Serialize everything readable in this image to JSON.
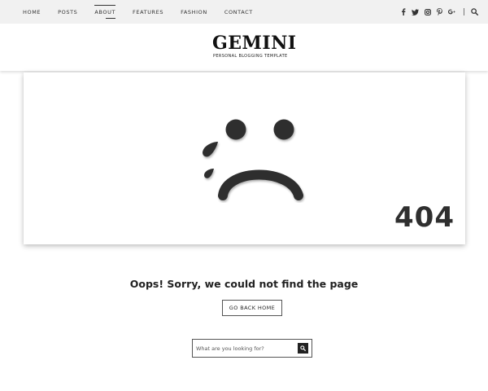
{
  "nav": {
    "items": [
      {
        "label": "HOME"
      },
      {
        "label": "POSTS"
      },
      {
        "label": "ABOUT"
      },
      {
        "label": "FEATURES"
      },
      {
        "label": "FASHION"
      },
      {
        "label": "CONTACT"
      }
    ],
    "active": "ABOUT",
    "social_icons": [
      "facebook-icon",
      "twitter-icon",
      "instagram-icon",
      "pinterest-icon",
      "google-plus-icon"
    ],
    "search_icon": "search-icon"
  },
  "header": {
    "logo_text": "GEMINI",
    "tagline": "PERSONAL BLOGGING TEMPLATE"
  },
  "error": {
    "code": "404",
    "illustration": "sad-face-with-tears",
    "message": "Oops! Sorry, we could not find the page",
    "home_button": "GO BACK HOME"
  },
  "search": {
    "placeholder": "What are you looking for?",
    "icon": "search-icon"
  },
  "colors": {
    "topbar_bg": "#f1f1f1",
    "text": "#222222",
    "face": "#2f2f2f"
  }
}
